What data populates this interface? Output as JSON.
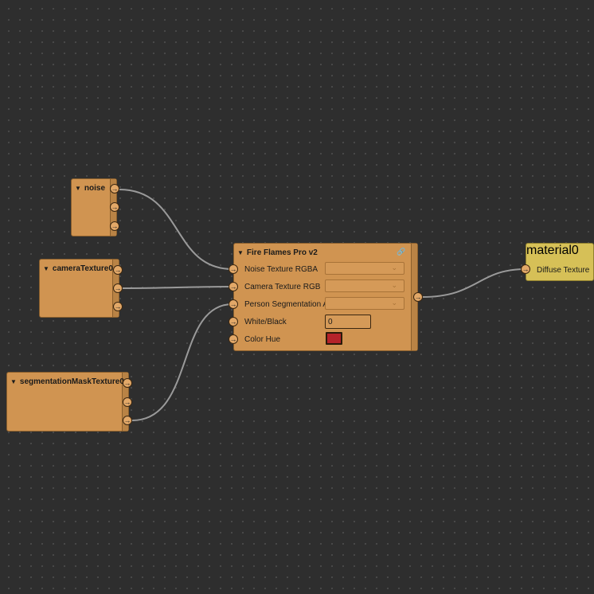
{
  "colors": {
    "canvas_bg": "#2e2e2e",
    "node_fill": "#d09451",
    "material_fill": "#d6c057",
    "wire": "#9a9a9a",
    "hue_swatch": "#b4232a"
  },
  "icons": {
    "collapse": "▼",
    "port_arrow": "→",
    "chevron": "⌄",
    "link": "🔗"
  },
  "nodes": {
    "noise": {
      "title": "noise"
    },
    "camera": {
      "title": "cameraTexture0"
    },
    "segmentation": {
      "title": "segmentationMaskTexture0"
    },
    "fire": {
      "title": "Fire Flames Pro v2",
      "inputs": [
        {
          "label": "Noise Texture RGBA"
        },
        {
          "label": "Camera Texture RGB"
        },
        {
          "label": "Person Segmentation A"
        },
        {
          "label": "White/Black",
          "value": "0"
        },
        {
          "label": "Color Hue"
        }
      ]
    },
    "material": {
      "title": "material0",
      "input": "Diffuse Texture"
    }
  }
}
